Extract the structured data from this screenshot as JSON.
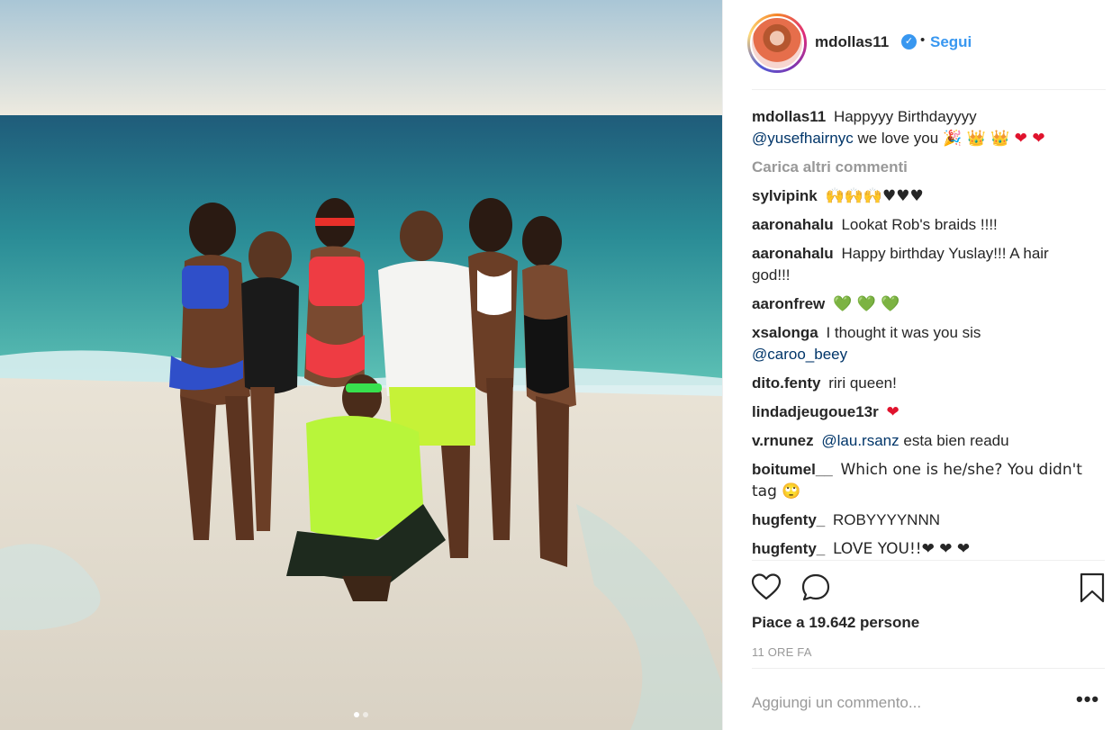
{
  "post": {
    "header": {
      "username": "mdollas11",
      "separator": "•",
      "follow_label": "Segui",
      "verified_icon": "verified-badge-icon",
      "verified_color": "#3897f0"
    },
    "caption": {
      "username": "mdollas11",
      "text": "Happyyy Birthdayyyy",
      "mention": "@yusefhairnyc",
      "text_after": "we love you",
      "emojis": "🎉 👑 👑 ❤ ❤"
    },
    "load_more_label": "Carica altri commenti",
    "comments": [
      {
        "user": "sylvipink",
        "text": "🙌🙌🙌♥♥♥"
      },
      {
        "user": "aaronahalu",
        "text": "Lookat Rob's braids !!!!"
      },
      {
        "user": "aaronahalu",
        "text": "Happy birthday Yuslay!!! A hair god!!!"
      },
      {
        "user": "aaronfrew",
        "text": "💚 💚 💚"
      },
      {
        "user": "xsalonga",
        "text": "I thought it was you sis",
        "mention": "@caroo_beey"
      },
      {
        "user": "dito.fenty",
        "text": "riri queen!"
      },
      {
        "user": "lindadjeugoue13r",
        "text": "❤"
      },
      {
        "user": "v.rnunez",
        "mention": "@lau.rsanz",
        "text": "esta bien readu"
      },
      {
        "user": "boitumel__",
        "text": "Which one is he/she? You didn't tag 🙄"
      },
      {
        "user": "hugfenty_",
        "text": "ROBYYYYNNN"
      },
      {
        "user": "hugfenty_",
        "text": "LOVE YOU!!❤ ❤ ❤"
      }
    ],
    "likes_text": "Piace a 19.642 persone",
    "time_text": "11 ORE FA",
    "add_comment_placeholder": "Aggiungi un commento...",
    "more_label": "•••",
    "carousel": {
      "count": 2,
      "active_index": 0
    },
    "colors": {
      "accent": "#3897f0",
      "mention": "#003569",
      "muted": "#999999",
      "heart": "#e0132d",
      "green_heart": "#27c21d"
    },
    "icons": [
      "heart-outline-icon",
      "comment-bubble-icon",
      "bookmark-icon",
      "more-options-icon"
    ]
  }
}
